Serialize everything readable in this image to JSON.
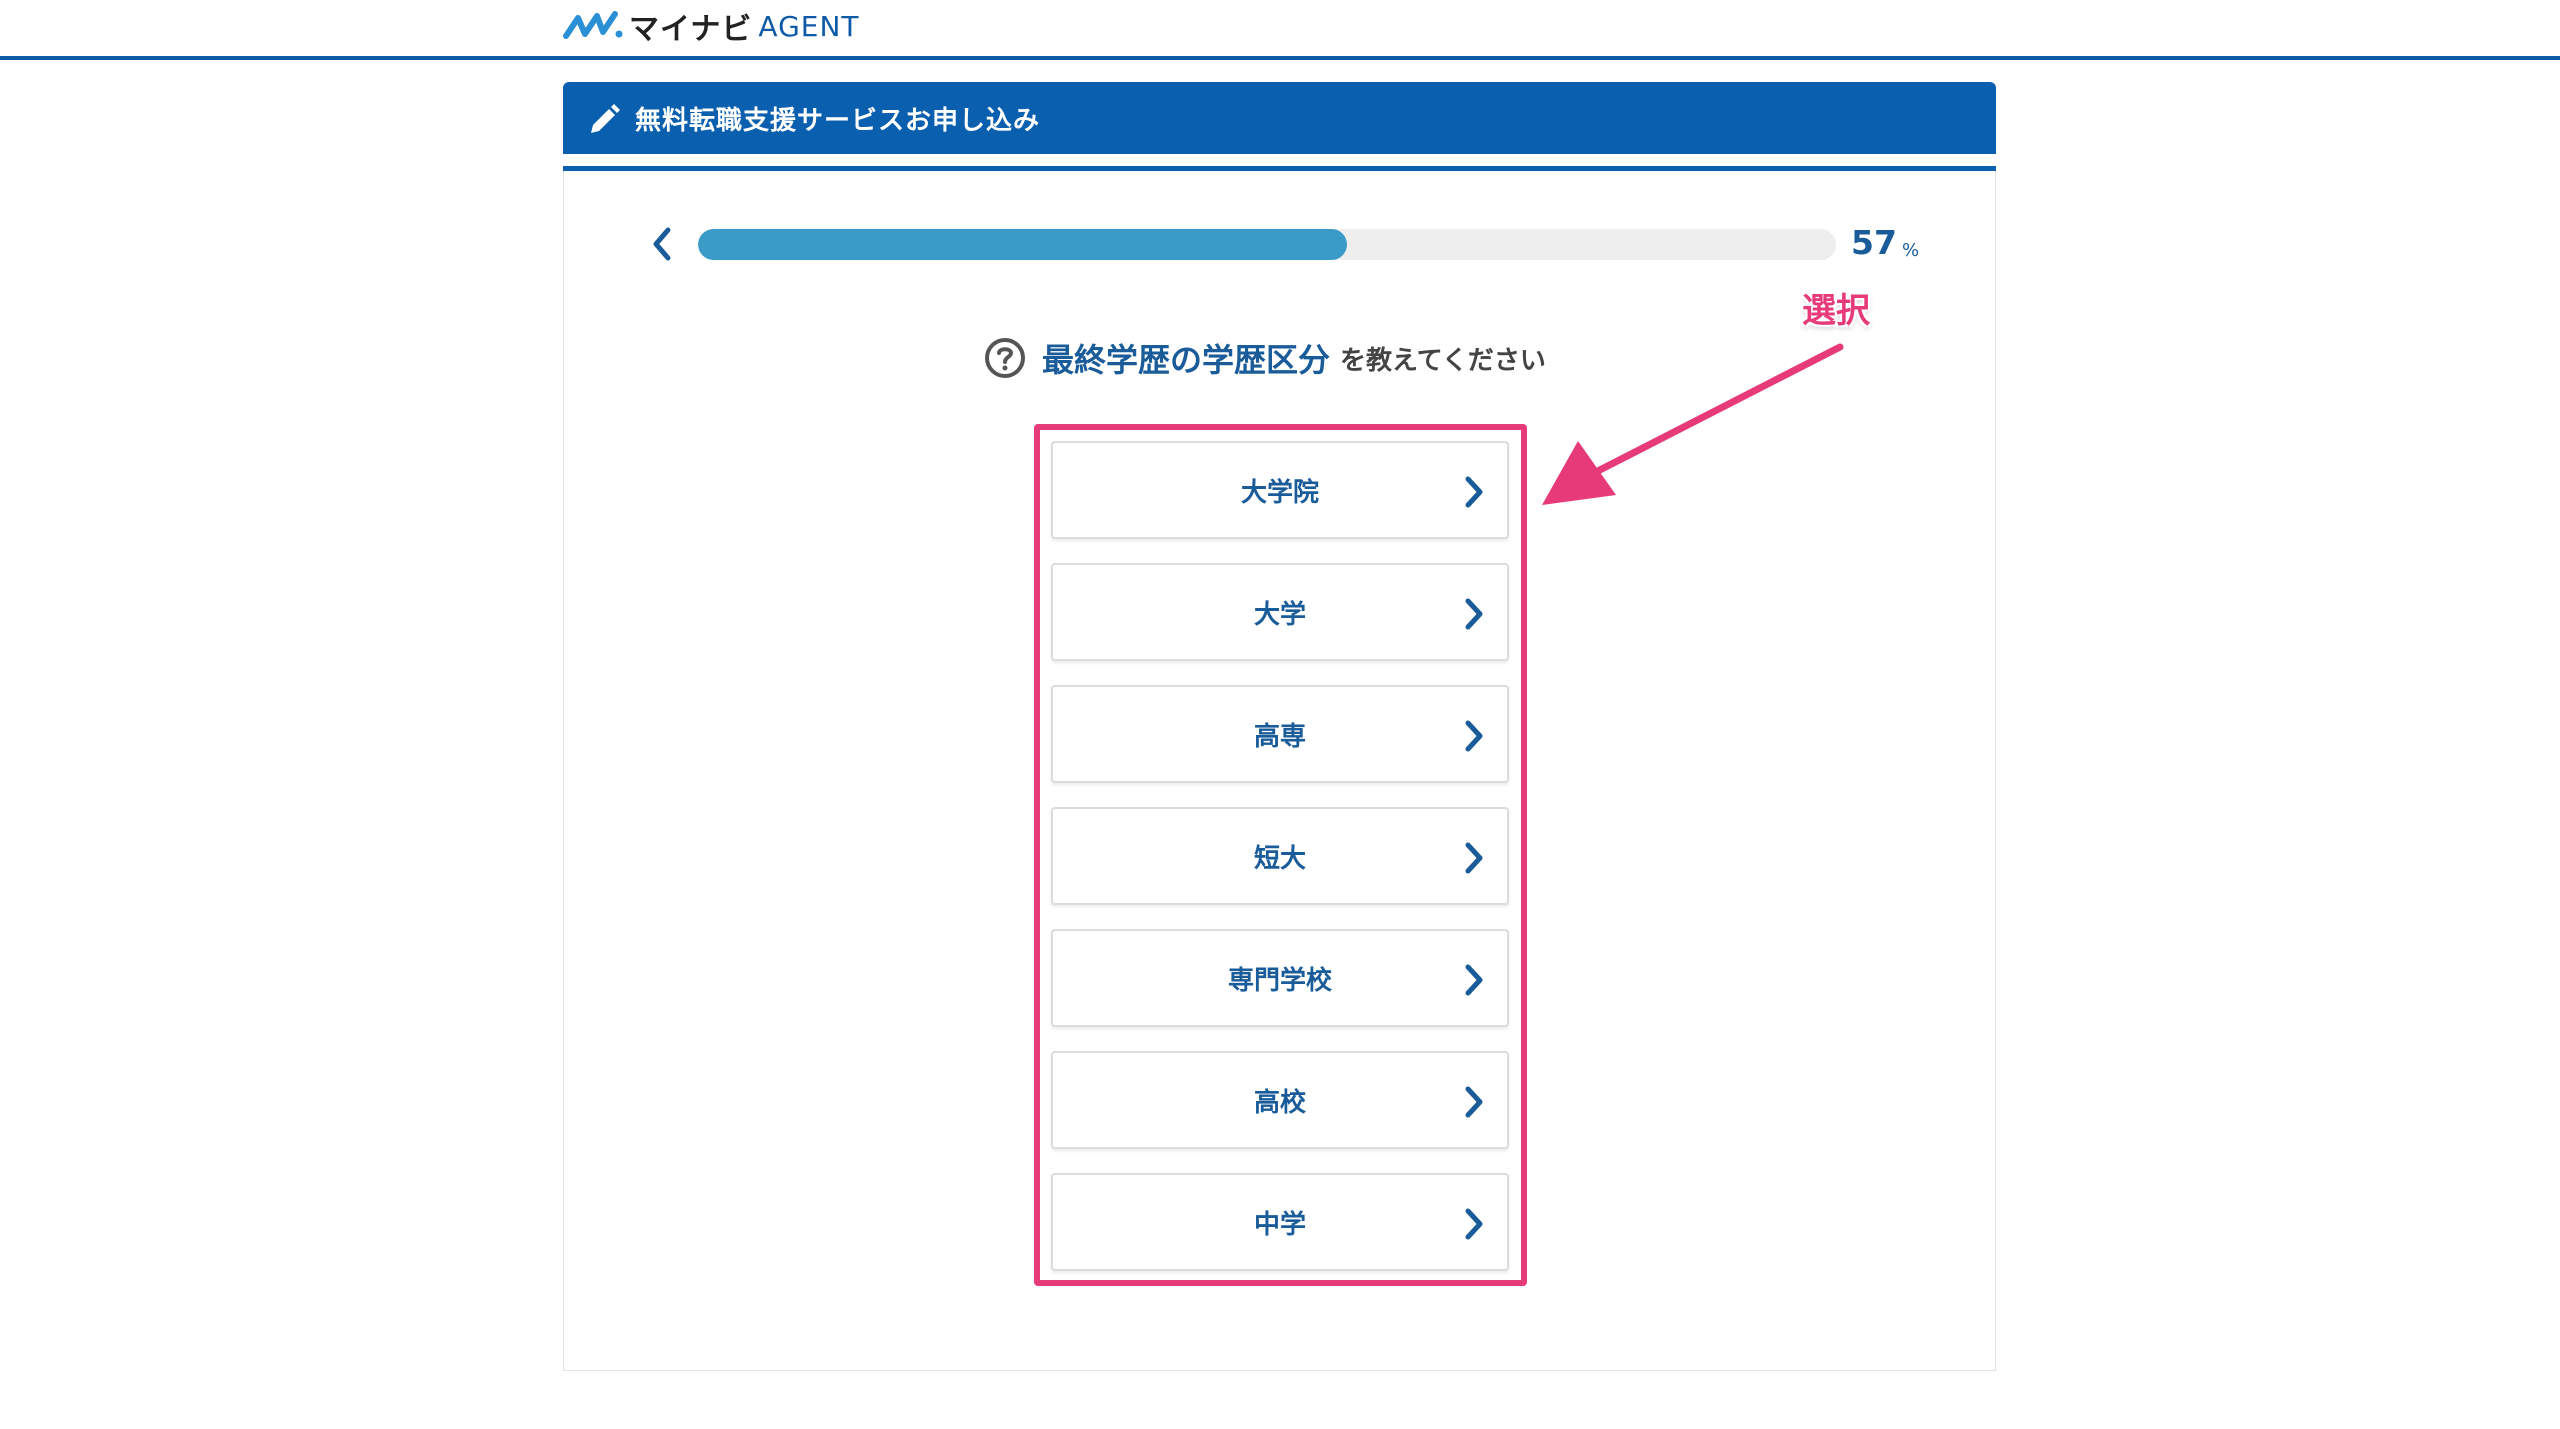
{
  "header": {
    "logo_text": "マイナビ",
    "logo_agent": "AGENT"
  },
  "banner": {
    "title": "無料転職支援サービスお申し込み"
  },
  "progress": {
    "value": "57",
    "unit": "%",
    "fraction": 0.57
  },
  "question": {
    "main": "最終学歴の学歴区分",
    "sub": "を教えてください"
  },
  "annotation": {
    "label": "選択"
  },
  "options": [
    {
      "label": "大学院"
    },
    {
      "label": "大学"
    },
    {
      "label": "高専"
    },
    {
      "label": "短大"
    },
    {
      "label": "専門学校"
    },
    {
      "label": "高校"
    },
    {
      "label": "中学"
    }
  ],
  "colors": {
    "brand": "#0a5fae",
    "progress": "#3a9bc8",
    "highlight": "#e73b79",
    "text": "#1a5c99"
  }
}
